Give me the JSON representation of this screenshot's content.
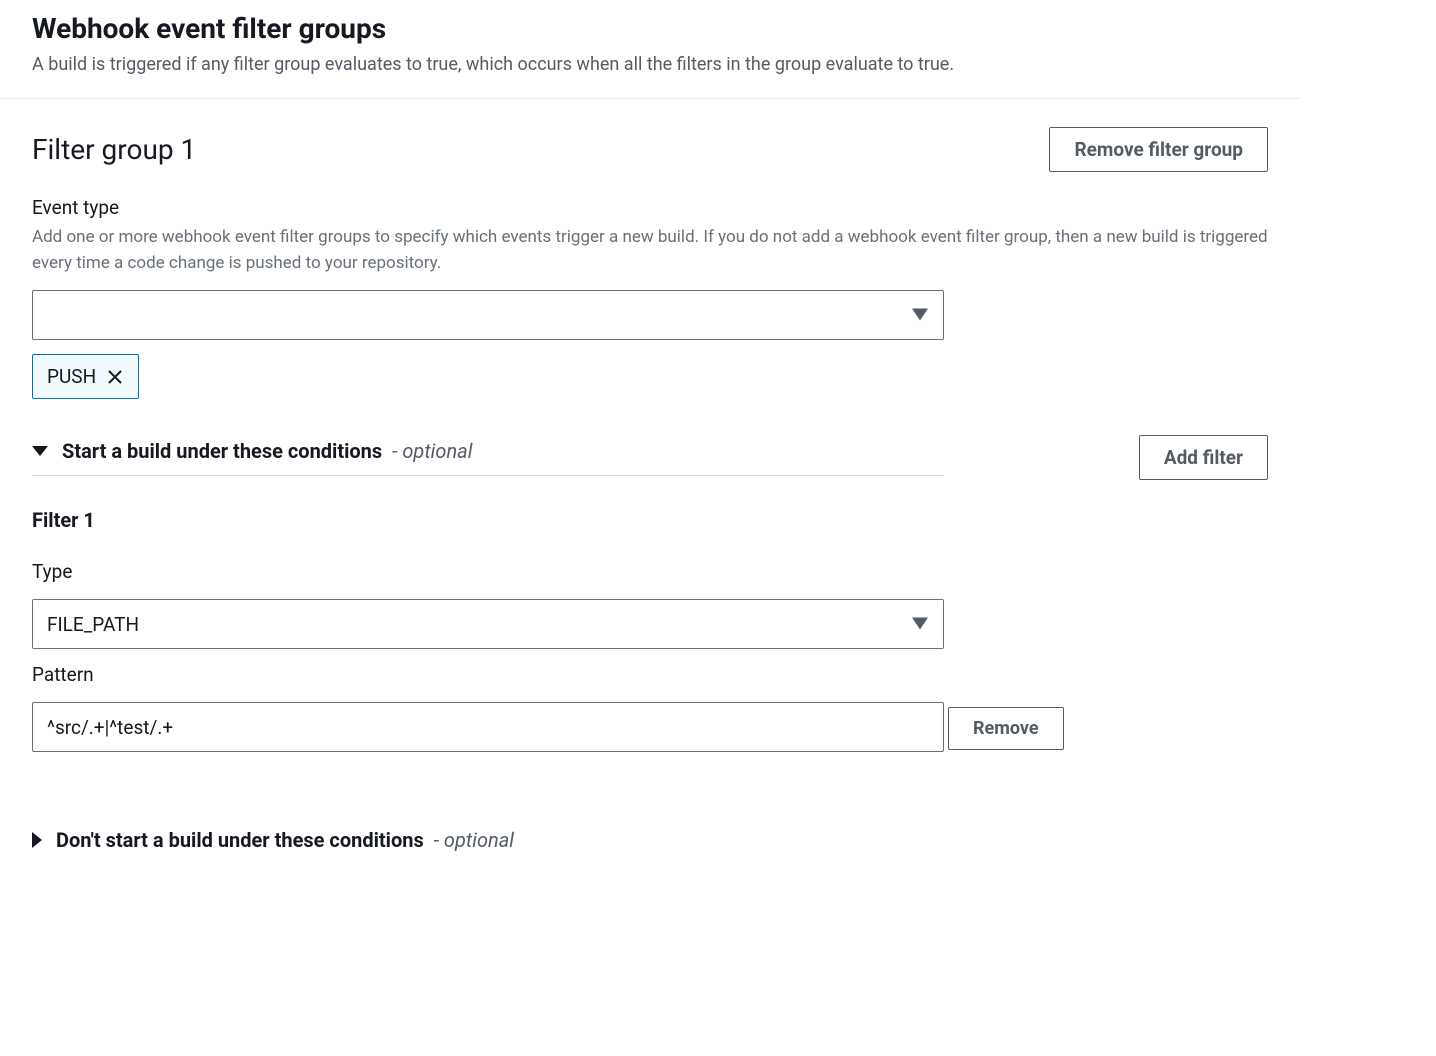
{
  "header": {
    "title": "Webhook event filter groups",
    "description": "A build is triggered if any filter group evaluates to true, which occurs when all the filters in the group evaluate to true."
  },
  "group": {
    "title": "Filter group 1",
    "removeLabel": "Remove filter group"
  },
  "eventType": {
    "label": "Event type",
    "description": "Add one or more webhook event filter groups to specify which events trigger a new build. If you do not add a webhook event filter group, then a new build is triggered every time a code change is pushed to your repository.",
    "tags": [
      "PUSH"
    ]
  },
  "startConditions": {
    "title": "Start a build under these conditions",
    "optionalLabel": "- optional",
    "addFilterLabel": "Add filter"
  },
  "filter1": {
    "title": "Filter 1",
    "typeLabel": "Type",
    "typeValue": "FILE_PATH",
    "patternLabel": "Pattern",
    "patternValue": "^src/.+|^test/.+",
    "removeLabel": "Remove"
  },
  "dontStartConditions": {
    "title": "Don't start a build under these conditions",
    "optionalLabel": "- optional"
  }
}
